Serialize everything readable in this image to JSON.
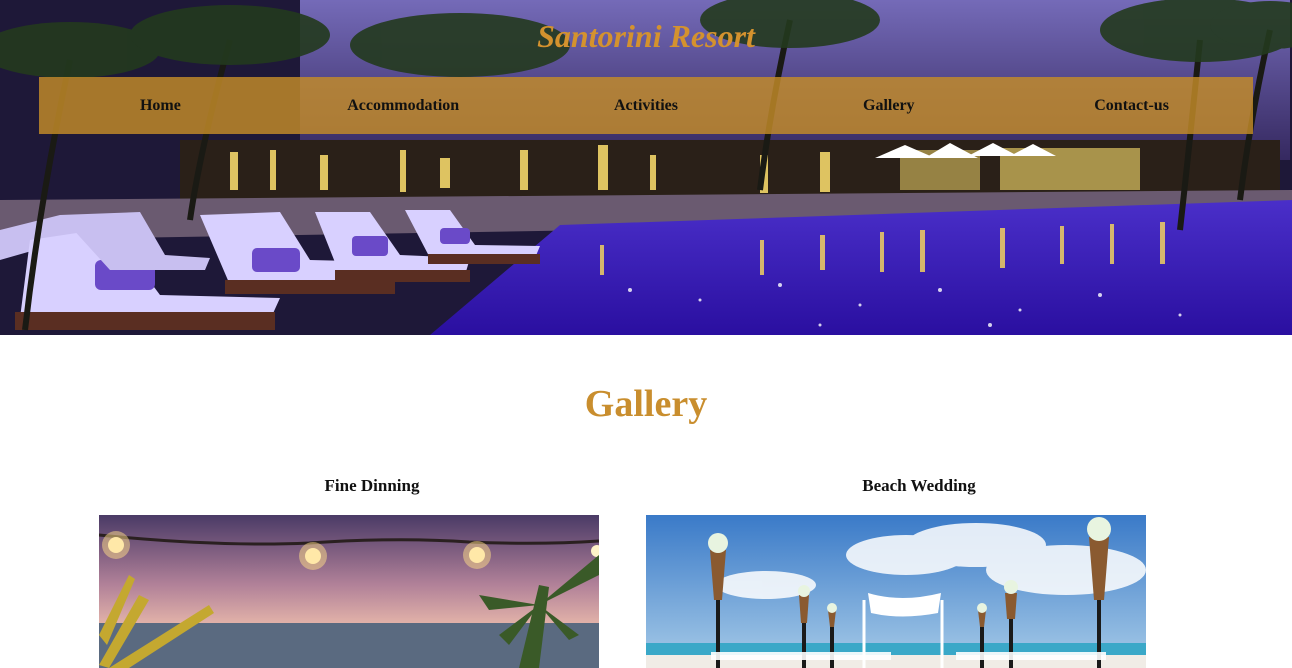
{
  "site": {
    "title": "Santorini Resort"
  },
  "nav": {
    "items": [
      {
        "label": "Home"
      },
      {
        "label": "Accommodation"
      },
      {
        "label": "Activities"
      },
      {
        "label": "Gallery"
      },
      {
        "label": "Contact-us"
      }
    ]
  },
  "gallery": {
    "heading": "Gallery",
    "cards": [
      {
        "title": "Fine Dinning"
      },
      {
        "title": "Beach Wedding"
      }
    ]
  },
  "colors": {
    "accent": "#d4922e",
    "nav_bg": "#c48c28",
    "heading": "#c98e2e"
  }
}
